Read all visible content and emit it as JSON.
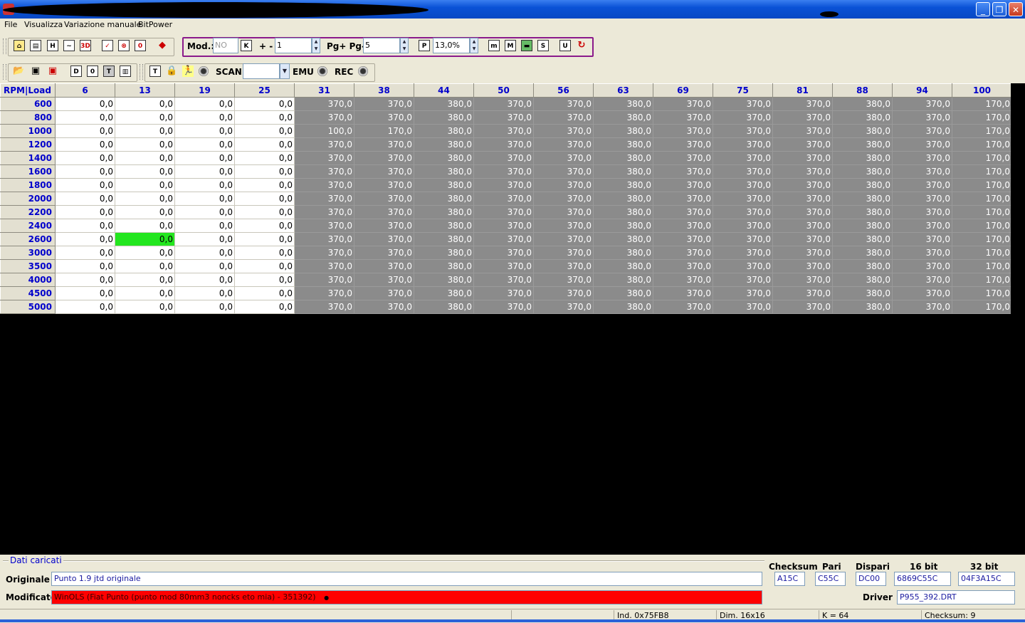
{
  "window": {
    "minimize_icon": "minimize-icon",
    "restore_icon": "restore-icon",
    "close_icon": "close-icon"
  },
  "menu": {
    "file": "File",
    "visualizza": "Visualizza",
    "variazione": "Variazione manuale",
    "bitpower": "BitPower"
  },
  "toolbar": {
    "mod_label": "Mod.:",
    "mod_value": "NO",
    "k_label": "K",
    "plus_minus_label": "+ -",
    "plus_minus_value": "1",
    "pg_label": "Pg+ Pg-",
    "pg_value": "5",
    "p_label": "P",
    "percent_value": "13,0%",
    "scan_label": "SCAN",
    "scan_value": "",
    "emu_label": "EMU",
    "rec_label": "REC",
    "icons_row1": [
      "H",
      "□",
      "T",
      "~",
      "3D",
      "✓",
      "⊗",
      "0"
    ],
    "icons_row1b": [
      "m",
      "M",
      "▬",
      "S",
      "U",
      "C"
    ],
    "icons_row2": [
      "📂",
      "💾",
      "💾",
      "D",
      "0",
      "T",
      "▥",
      "T",
      "🔒",
      "🏃"
    ]
  },
  "map": {
    "corner": "RPM|Load",
    "cols": [
      "6",
      "13",
      "19",
      "25",
      "31",
      "38",
      "44",
      "50",
      "56",
      "63",
      "69",
      "75",
      "81",
      "88",
      "94",
      "100"
    ],
    "rows": [
      "600",
      "800",
      "1000",
      "1200",
      "1400",
      "1600",
      "1800",
      "2000",
      "2200",
      "2400",
      "2600",
      "3000",
      "3500",
      "4000",
      "4500",
      "5000"
    ],
    "values": [
      [
        "0,0",
        "0,0",
        "0,0",
        "0,0",
        "370,0",
        "370,0",
        "380,0",
        "370,0",
        "370,0",
        "380,0",
        "370,0",
        "370,0",
        "370,0",
        "380,0",
        "370,0",
        "170,0"
      ],
      [
        "0,0",
        "0,0",
        "0,0",
        "0,0",
        "370,0",
        "370,0",
        "380,0",
        "370,0",
        "370,0",
        "380,0",
        "370,0",
        "370,0",
        "370,0",
        "380,0",
        "370,0",
        "170,0"
      ],
      [
        "0,0",
        "0,0",
        "0,0",
        "0,0",
        "100,0",
        "170,0",
        "380,0",
        "370,0",
        "370,0",
        "380,0",
        "370,0",
        "370,0",
        "370,0",
        "380,0",
        "370,0",
        "170,0"
      ],
      [
        "0,0",
        "0,0",
        "0,0",
        "0,0",
        "370,0",
        "370,0",
        "380,0",
        "370,0",
        "370,0",
        "380,0",
        "370,0",
        "370,0",
        "370,0",
        "380,0",
        "370,0",
        "170,0"
      ],
      [
        "0,0",
        "0,0",
        "0,0",
        "0,0",
        "370,0",
        "370,0",
        "380,0",
        "370,0",
        "370,0",
        "380,0",
        "370,0",
        "370,0",
        "370,0",
        "380,0",
        "370,0",
        "170,0"
      ],
      [
        "0,0",
        "0,0",
        "0,0",
        "0,0",
        "370,0",
        "370,0",
        "380,0",
        "370,0",
        "370,0",
        "380,0",
        "370,0",
        "370,0",
        "370,0",
        "380,0",
        "370,0",
        "170,0"
      ],
      [
        "0,0",
        "0,0",
        "0,0",
        "0,0",
        "370,0",
        "370,0",
        "380,0",
        "370,0",
        "370,0",
        "380,0",
        "370,0",
        "370,0",
        "370,0",
        "380,0",
        "370,0",
        "170,0"
      ],
      [
        "0,0",
        "0,0",
        "0,0",
        "0,0",
        "370,0",
        "370,0",
        "380,0",
        "370,0",
        "370,0",
        "380,0",
        "370,0",
        "370,0",
        "370,0",
        "380,0",
        "370,0",
        "170,0"
      ],
      [
        "0,0",
        "0,0",
        "0,0",
        "0,0",
        "370,0",
        "370,0",
        "380,0",
        "370,0",
        "370,0",
        "380,0",
        "370,0",
        "370,0",
        "370,0",
        "380,0",
        "370,0",
        "170,0"
      ],
      [
        "0,0",
        "0,0",
        "0,0",
        "0,0",
        "370,0",
        "370,0",
        "380,0",
        "370,0",
        "370,0",
        "380,0",
        "370,0",
        "370,0",
        "370,0",
        "380,0",
        "370,0",
        "170,0"
      ],
      [
        "0,0",
        "0,0",
        "0,0",
        "0,0",
        "370,0",
        "370,0",
        "380,0",
        "370,0",
        "370,0",
        "380,0",
        "370,0",
        "370,0",
        "370,0",
        "380,0",
        "370,0",
        "170,0"
      ],
      [
        "0,0",
        "0,0",
        "0,0",
        "0,0",
        "370,0",
        "370,0",
        "380,0",
        "370,0",
        "370,0",
        "380,0",
        "370,0",
        "370,0",
        "370,0",
        "380,0",
        "370,0",
        "170,0"
      ],
      [
        "0,0",
        "0,0",
        "0,0",
        "0,0",
        "370,0",
        "370,0",
        "380,0",
        "370,0",
        "370,0",
        "380,0",
        "370,0",
        "370,0",
        "370,0",
        "380,0",
        "370,0",
        "170,0"
      ],
      [
        "0,0",
        "0,0",
        "0,0",
        "0,0",
        "370,0",
        "370,0",
        "380,0",
        "370,0",
        "370,0",
        "380,0",
        "370,0",
        "370,0",
        "370,0",
        "380,0",
        "370,0",
        "170,0"
      ],
      [
        "0,0",
        "0,0",
        "0,0",
        "0,0",
        "370,0",
        "370,0",
        "380,0",
        "370,0",
        "370,0",
        "380,0",
        "370,0",
        "370,0",
        "370,0",
        "380,0",
        "370,0",
        "170,0"
      ],
      [
        "0,0",
        "0,0",
        "0,0",
        "0,0",
        "370,0",
        "370,0",
        "380,0",
        "370,0",
        "370,0",
        "380,0",
        "370,0",
        "370,0",
        "370,0",
        "380,0",
        "370,0",
        "170,0"
      ]
    ],
    "white_cols": 4,
    "selected_cell": {
      "row": 10,
      "col": 1
    },
    "colors": {
      "white_cell": "#ffffff",
      "grey_cell": "#8b8b8b",
      "selected": "#23e61f",
      "header_text": "#0000cc"
    }
  },
  "panel": {
    "title": "Dati caricati",
    "originale_label": "Originale",
    "originale_value": "Punto 1.9 jtd originale",
    "modificato_label": "Modificato",
    "modificato_value": "WinOLS (Fiat Punto (punto mod 80mm3 noncks eto mia) - 351392)",
    "modificato_marker": "●",
    "checksum_label": "Checksum",
    "checksum_value": "A15C",
    "pari_label": "Pari",
    "pari_value": "C55C",
    "dispari_label": "Dispari",
    "dispari_value": "DC00",
    "bit16_label": "16 bit",
    "bit16_value": "6869C55C",
    "bit32_label": "32 bit",
    "bit32_value": "04F3A15C",
    "driver_label": "Driver",
    "driver_value": "P955_392.DRT"
  },
  "status": {
    "ind": "Ind. 0x75FB8",
    "dim": "Dim. 16x16",
    "k": "K = 64",
    "checksum": "Checksum: 9"
  }
}
